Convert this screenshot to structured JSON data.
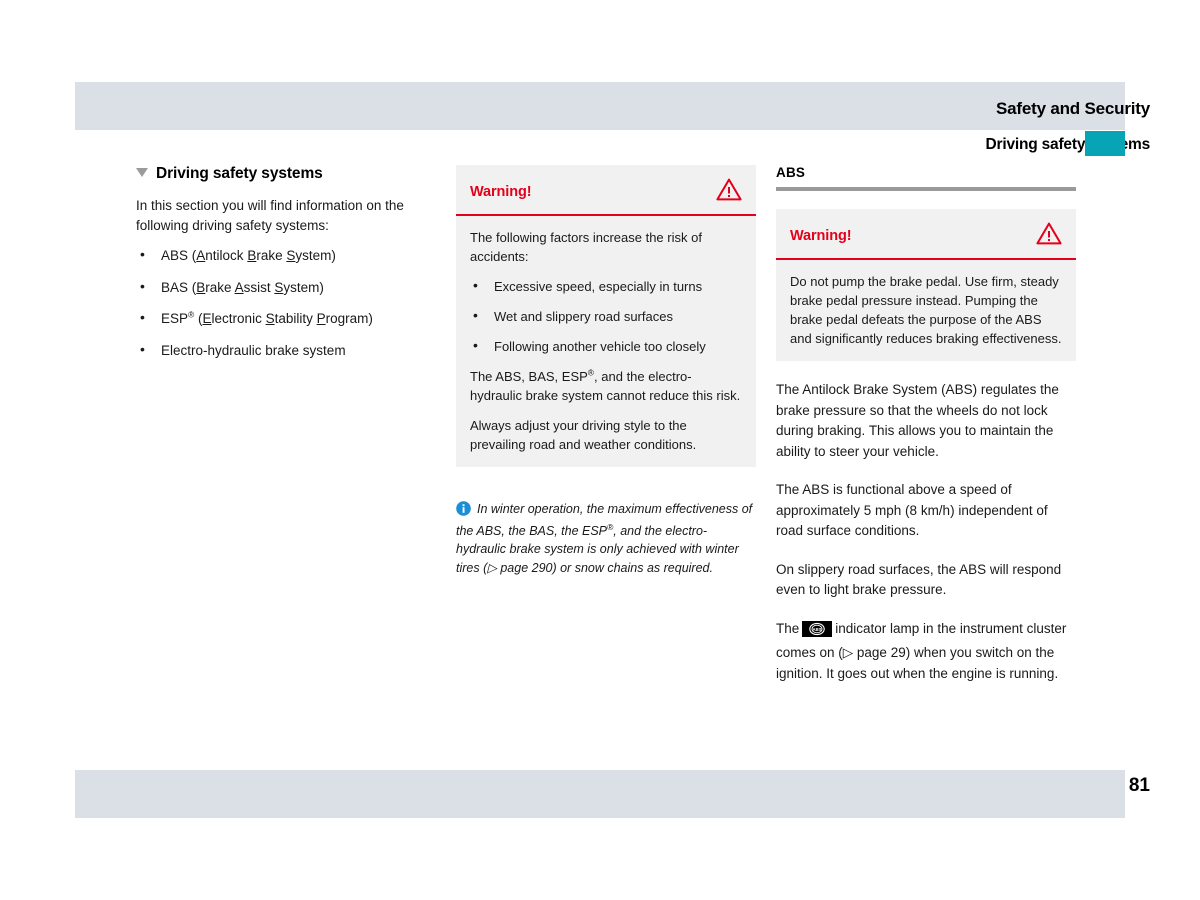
{
  "header": {
    "title": "Safety and Security",
    "subtitle": "Driving safety systems",
    "tab_color": "#06a4b4",
    "bar_color": "#dbe0e6"
  },
  "left_column": {
    "heading": "Driving safety systems",
    "intro": "In this section you will find information on the following driving safety systems:",
    "bullets": [
      "ABS (Antilock Brake System)",
      "BAS (Brake Assist System)",
      "ESP® (Electronic Stability Program)",
      "Electro-hydraulic brake system"
    ]
  },
  "middle_column": {
    "warning": {
      "title": "Warning!",
      "icon": "warning-triangle-icon",
      "accent_color": "#e3001b",
      "intro": "The following factors increase the risk of accidents:",
      "bullets": [
        "Excessive speed, especially in turns",
        "Wet and slippery road surfaces",
        "Following another vehicle too closely"
      ],
      "paragraph_1": "The ABS, BAS, ESP®, and the electro-hydraulic brake system cannot reduce this risk.",
      "paragraph_2": "Always adjust your driving style to the prevailing road and weather conditions."
    },
    "note": {
      "icon": "info-icon",
      "icon_color": "#1b8fd4",
      "text": "In winter operation, the maximum effectiveness of the ABS, the BAS, the ESP®, and the electro-hydraulic brake system is only achieved with winter tires (▷ page 290) or snow chains as required."
    }
  },
  "right_column": {
    "subheading": "ABS",
    "warning": {
      "title": "Warning!",
      "icon": "warning-triangle-icon",
      "accent_color": "#e3001b",
      "text": "Do not pump the brake pedal. Use firm, steady brake pedal pressure instead. Pumping the brake pedal defeats the purpose of the ABS and significantly reduces braking effectiveness."
    },
    "paragraphs": [
      "The Antilock Brake System (ABS) regulates the brake pressure so that the wheels do not lock during braking. This allows you to maintain the ability to steer your vehicle.",
      "The ABS is functional above a speed of approximately 5 mph (8 km/h) independent of road surface conditions.",
      "On slippery road surfaces, the ABS will respond even to light brake pressure."
    ],
    "lamp_paragraph": {
      "before": "The",
      "lamp_icon": "abs-indicator-lamp-icon",
      "lamp_label": "ABS",
      "after": "indicator lamp in the instrument cluster comes on (▷ page 29) when you switch on the ignition. It goes out when the engine is running."
    }
  },
  "footer": {
    "page_number": "81"
  }
}
